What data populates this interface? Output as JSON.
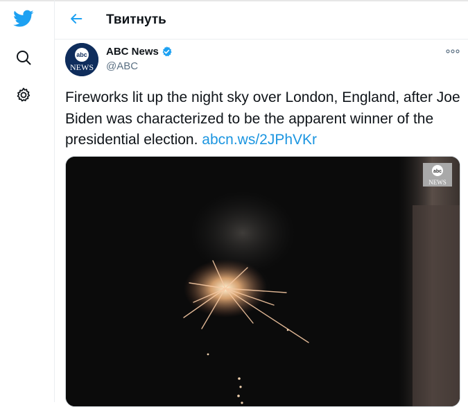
{
  "nav": {
    "logo_icon": "twitter-bird-icon",
    "search_icon": "search-icon",
    "settings_icon": "gear-icon"
  },
  "header": {
    "back_icon": "back-arrow-icon",
    "title": "Твитнуть"
  },
  "tweet": {
    "author_name": "ABC News",
    "handle": "@ABC",
    "avatar_text_top": "abc",
    "avatar_text_bottom": "NEWS",
    "verified_icon": "verified-badge-icon",
    "more_icon": "more-dots-icon",
    "text": "Fireworks lit up the night sky over London, England, after Joe Biden was characterized to be the apparent winner of the presidential election. ",
    "link": "abcn.ws/2JPhVKr",
    "media": {
      "logo_top": "abc",
      "logo_bottom": "NEWS"
    }
  },
  "colors": {
    "accent": "#1da1f2",
    "link": "#1b95e0",
    "text": "#0f1419",
    "secondary": "#5b7083"
  }
}
